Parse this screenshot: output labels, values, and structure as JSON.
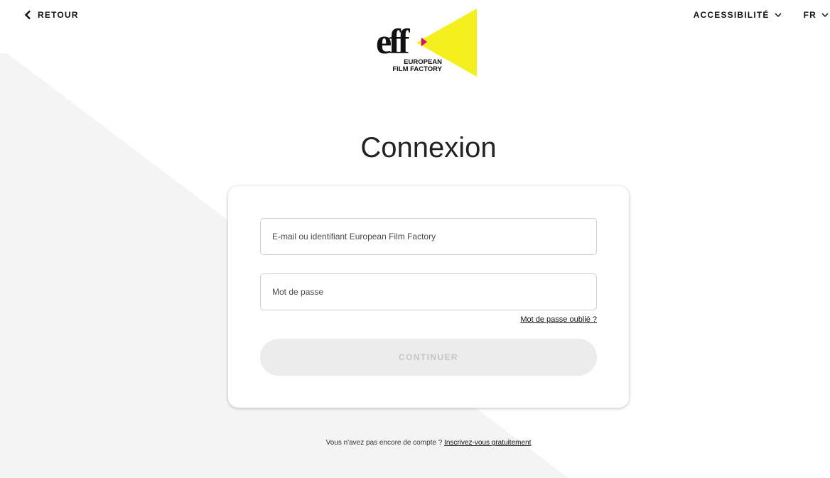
{
  "nav": {
    "back_label": "RETOUR",
    "accessibility_label": "ACCESSIBILITÉ",
    "language_label": "FR"
  },
  "logo": {
    "wordmark": "eff",
    "caption_line1": "EUROPEAN",
    "caption_line2": "FILM FACTORY"
  },
  "login": {
    "title": "Connexion",
    "email_placeholder": "E-mail ou identifiant European Film Factory",
    "password_placeholder": "Mot de passe",
    "forgot_password": "Mot de passe oublié ?",
    "continue_label": "CONTINUER"
  },
  "signup": {
    "prompt": "Vous n'avez pas encore de compte ?",
    "link": "Inscrivez-vous gratuitement"
  },
  "colors": {
    "accent_yellow": "#f4f020",
    "accent_magenta": "#e4007c",
    "button_disabled_bg": "#ececec",
    "button_disabled_text": "#c5c5c5",
    "background_shape": "#f4f4f4"
  },
  "icons": {
    "back": "chevron-left-icon",
    "dropdown": "chevron-down-icon"
  }
}
